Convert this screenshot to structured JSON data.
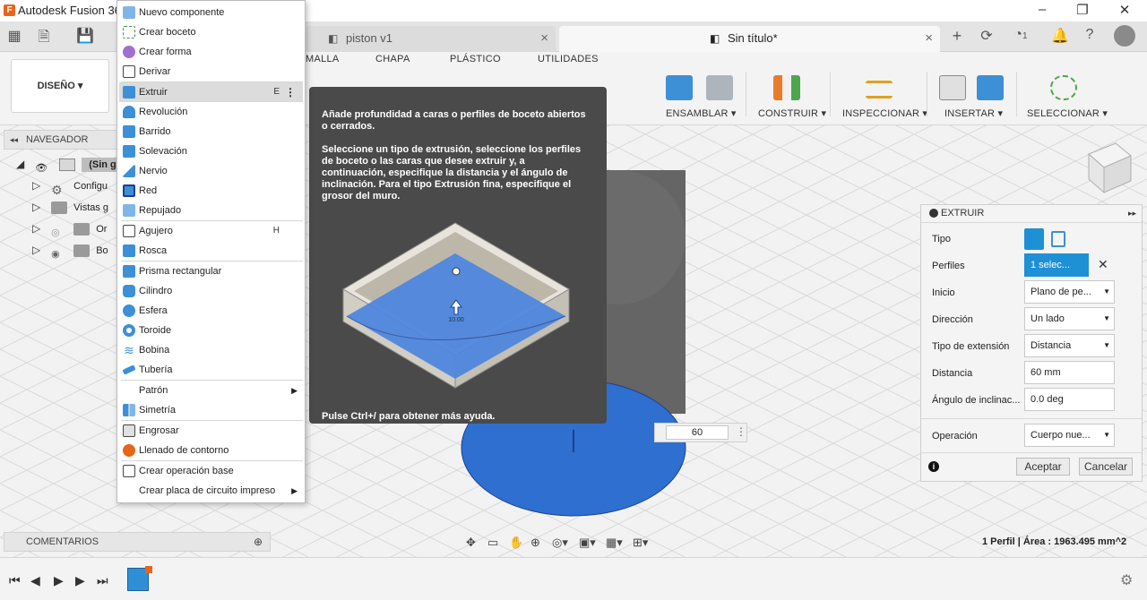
{
  "window": {
    "title": "Autodesk Fusion 360"
  },
  "tabs": [
    {
      "label": "piston v1"
    },
    {
      "label": "Sin título*"
    }
  ],
  "toolbar_right": {
    "jobs_count": "1"
  },
  "ribbon": {
    "design_label": "DISEÑO",
    "tabs": [
      "MALLA",
      "CHAPA",
      "PLÁSTICO",
      "UTILIDADES"
    ],
    "groups": [
      "ENSAMBLAR",
      "CONSTRUIR",
      "INSPECCIONAR",
      "INSERTAR",
      "SELECCIONAR"
    ]
  },
  "browser": {
    "header": "NAVEGADOR",
    "rows": [
      {
        "label": "(Sin g"
      },
      {
        "label": "Configu"
      },
      {
        "label": "Vistas g"
      },
      {
        "label": "Or"
      },
      {
        "label": "Bo"
      }
    ]
  },
  "menu": {
    "items": [
      {
        "label": "Nuevo componente"
      },
      {
        "label": "Crear boceto"
      },
      {
        "label": "Crear forma"
      },
      {
        "label": "Derivar"
      },
      {
        "label": "Extruir",
        "shortcut": "E"
      },
      {
        "label": "Revolución"
      },
      {
        "label": "Barrido"
      },
      {
        "label": "Solevación"
      },
      {
        "label": "Nervio"
      },
      {
        "label": "Red"
      },
      {
        "label": "Repujado"
      },
      {
        "label": "Agujero",
        "shortcut": "H"
      },
      {
        "label": "Rosca"
      },
      {
        "label": "Prisma rectangular"
      },
      {
        "label": "Cilindro"
      },
      {
        "label": "Esfera"
      },
      {
        "label": "Toroide"
      },
      {
        "label": "Bobina"
      },
      {
        "label": "Tubería"
      },
      {
        "label": "Patrón"
      },
      {
        "label": "Simetría"
      },
      {
        "label": "Engrosar"
      },
      {
        "label": "Llenado de contorno"
      },
      {
        "label": "Crear operación base"
      },
      {
        "label": "Crear placa de circuito impreso"
      }
    ]
  },
  "tooltip": {
    "p1": "Añade profundidad a caras o perfiles de boceto abiertos o cerrados.",
    "p2": "Seleccione un tipo de extrusión, seleccione los perfiles de boceto o las caras que desee extruir y, a continuación, especifique la distancia y el ángulo de inclinación. Para el tipo Extrusión fina, especifique el grosor del muro.",
    "dimension": "10.00",
    "help": "Pulse Ctrl+/ para obtener más ayuda."
  },
  "viewport": {
    "distance_input": "60"
  },
  "extrude_panel": {
    "title": "EXTRUIR",
    "fields": [
      {
        "label": "Tipo"
      },
      {
        "label": "Perfiles",
        "value": "1 selec..."
      },
      {
        "label": "Inicio",
        "value": "Plano de pe..."
      },
      {
        "label": "Dirección",
        "value": "Un lado"
      },
      {
        "label": "Tipo de extensión",
        "value": "Distancia"
      },
      {
        "label": "Distancia",
        "value": "60 mm"
      },
      {
        "label": "Ángulo de inclinac...",
        "value": "0.0 deg"
      },
      {
        "label": "Operación",
        "value": "Cuerpo nue..."
      }
    ],
    "ok_label": "Aceptar",
    "cancel_label": "Cancelar"
  },
  "comments": {
    "header": "COMENTARIOS"
  },
  "status": {
    "text": "1 Perfil | Área : 1963.495 mm^2"
  },
  "colors": {
    "accent_blue": "#1e90d6",
    "profile_blue": "#2f6fd0",
    "tooltip_bg": "#4a4a4a"
  }
}
